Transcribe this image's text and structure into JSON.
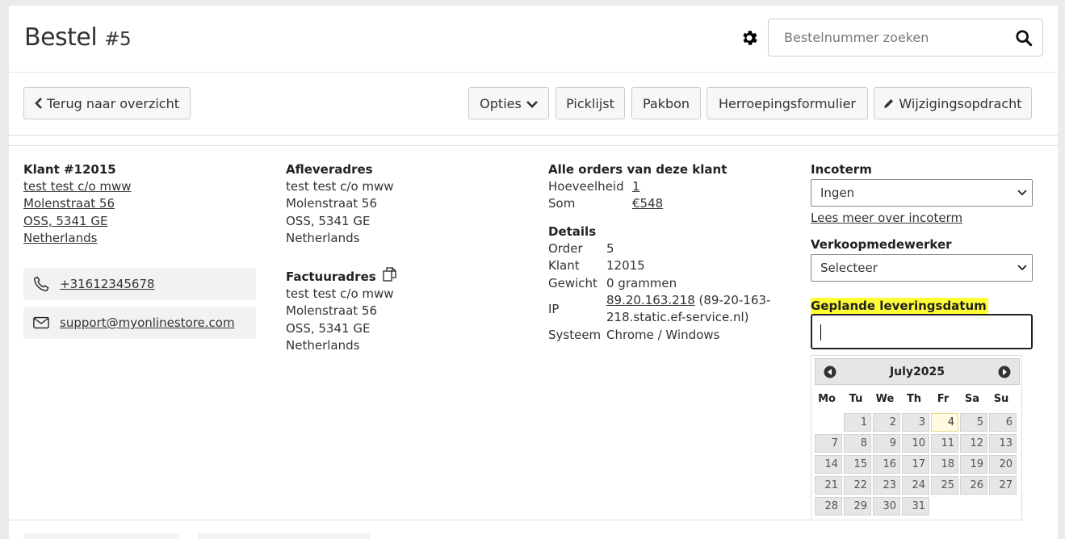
{
  "page": {
    "title": "Bestel",
    "order_no": "#5"
  },
  "search": {
    "placeholder": "Bestelnummer zoeken"
  },
  "toolbar": {
    "back": "Terug naar overzicht",
    "options": "Opties",
    "picklist": "Picklijst",
    "packing_slip": "Pakbon",
    "withdrawal_form": "Herroepingsformulier",
    "change_order": "Wijzigingsopdracht"
  },
  "customer": {
    "heading": "Klant #12015",
    "name": "test test c/o mww",
    "street": "Molenstraat 56",
    "city": "OSS, 5341 GE",
    "country": "Netherlands",
    "phone": "+31612345678",
    "email": "support@myonlinestore.com"
  },
  "delivery": {
    "heading": "Afleveradres",
    "name": "test test c/o mww",
    "street": "Molenstraat 56",
    "city": "OSS, 5341 GE",
    "country": "Netherlands"
  },
  "invoice": {
    "heading": "Factuuradres",
    "name": "test test c/o mww",
    "street": "Molenstraat 56",
    "city": "OSS, 5341 GE",
    "country": "Netherlands"
  },
  "orders": {
    "heading": "Alle orders van deze klant",
    "qty_label": "Hoeveelheid",
    "qty_value": "1",
    "sum_label": "Som",
    "sum_value": "€548"
  },
  "details": {
    "heading": "Details",
    "order_label": "Order",
    "order_value": "5",
    "customer_label": "Klant",
    "customer_value": "12015",
    "weight_label": "Gewicht",
    "weight_value": "0 grammen",
    "ip_label": "IP",
    "ip_link": "89.20.163.218",
    "ip_host": " (89-20-163-218.static.ef-service.nl)",
    "system_label": "Systeem",
    "system_value": "Chrome / Windows"
  },
  "incoterm": {
    "label": "Incoterm",
    "value": "Ingen",
    "more_link": "Lees meer over incoterm"
  },
  "salesperson": {
    "label": "Verkoopmedewerker",
    "value": "Selecteer"
  },
  "planned_delivery": {
    "label": "Geplande leveringsdatum",
    "value": ""
  },
  "datepicker": {
    "month": "July",
    "year": "2025",
    "dows": [
      "Mo",
      "Tu",
      "We",
      "Th",
      "Fr",
      "Sa",
      "Su"
    ],
    "today": "4",
    "days": [
      "",
      "1",
      "2",
      "3",
      "4",
      "5",
      "6",
      "7",
      "8",
      "9",
      "10",
      "11",
      "12",
      "13",
      "14",
      "15",
      "16",
      "17",
      "18",
      "19",
      "20",
      "21",
      "22",
      "23",
      "24",
      "25",
      "26",
      "27",
      "28",
      "29",
      "30",
      "31"
    ]
  }
}
